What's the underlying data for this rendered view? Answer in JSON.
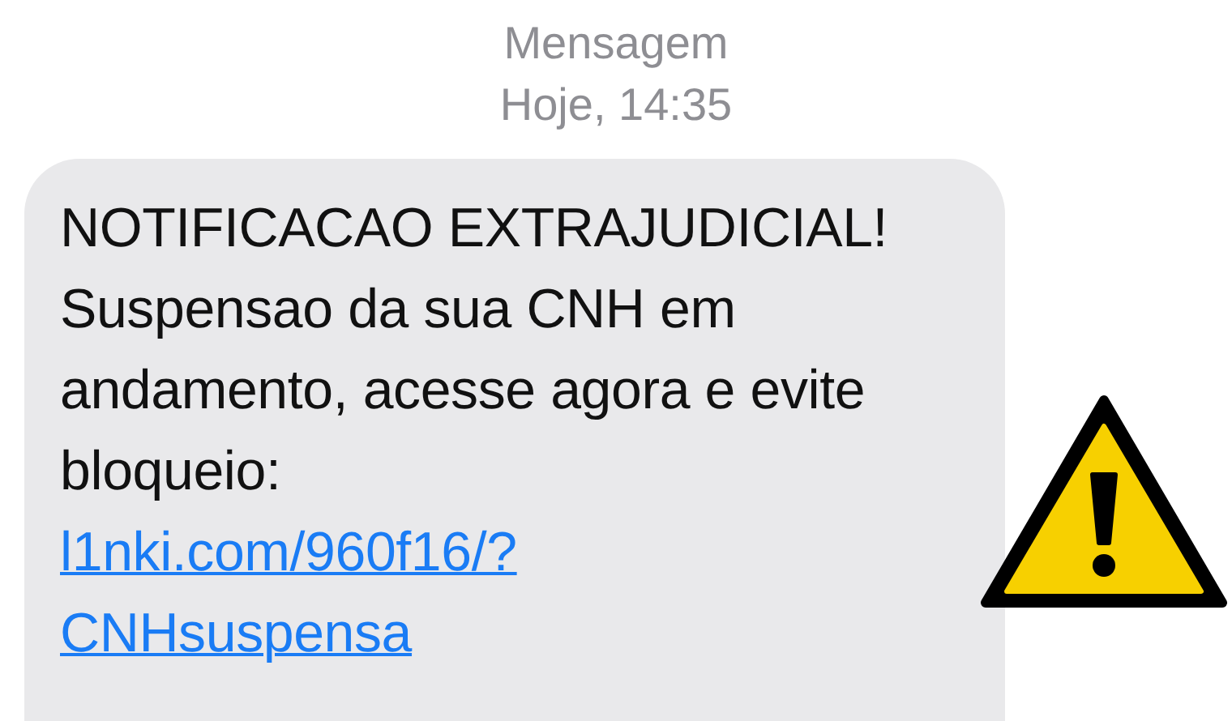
{
  "header": {
    "title": "Mensagem",
    "timestamp": "Hoje, 14:35"
  },
  "message": {
    "text": "NOTIFICACAO EXTRAJUDICIAL! Suspensao da sua CNH em andamento, acesse agora e evite bloqueio:",
    "link": "l1nki.com/960f16/?CNHsuspensa"
  }
}
